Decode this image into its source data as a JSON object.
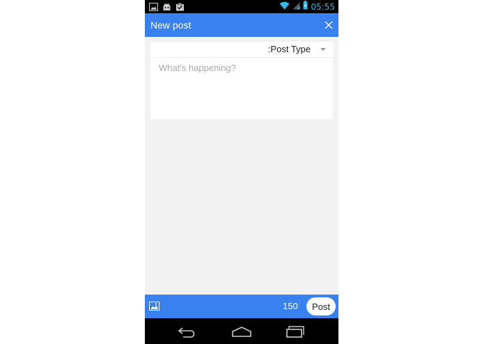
{
  "status_bar": {
    "time": "05:55",
    "left_icons": [
      "image-icon",
      "android-icon",
      "clipboard-check-icon"
    ],
    "right_icons": [
      "wifi-icon",
      "signal-icon",
      "battery-icon"
    ],
    "time_color": "#33b5e5"
  },
  "app_bar": {
    "title": "New post",
    "close_icon": "close-icon",
    "color": "#3a81f0"
  },
  "compose": {
    "post_type_label": ":Post Type",
    "placeholder": "What's happening?",
    "value": ""
  },
  "toolbar": {
    "image_icon": "image-icon",
    "char_count": "150",
    "post_label": "Post"
  },
  "nav_bar": {
    "buttons": [
      "back-icon",
      "home-icon",
      "recent-apps-icon"
    ]
  }
}
